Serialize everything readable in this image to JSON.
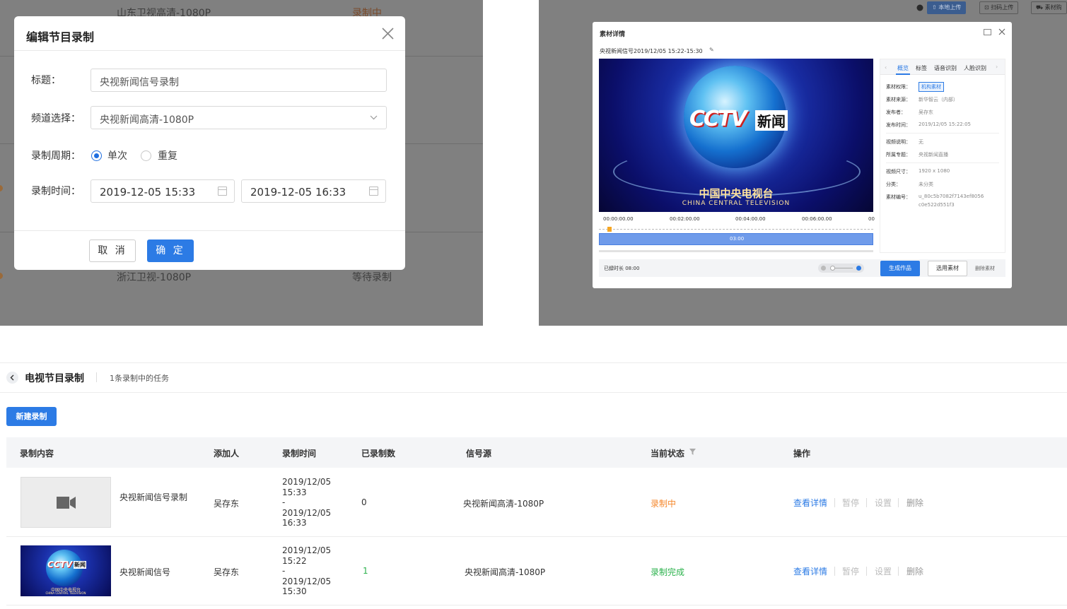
{
  "panel_a": {
    "background_rows": [
      {
        "channel": "山东卫视高清-1080P",
        "status": "录制中"
      },
      {
        "channel": "浙江卫视-1080P",
        "status": "等待录制"
      }
    ],
    "dialog": {
      "title": "编辑节目录制",
      "fields": {
        "title_label": "标题：",
        "title_value": "央视新闻信号录制",
        "channel_label": "频道选择：",
        "channel_value": "央视新闻高清-1080P",
        "period_label": "录制周期：",
        "period_options": [
          "单次",
          "重复"
        ],
        "period_selected": "单次",
        "time_label": "录制时间：",
        "time_start": "2019-12-05 15:33",
        "time_end": "2019-12-05 16:33"
      },
      "cancel_label": "取 消",
      "ok_label": "确 定"
    }
  },
  "panel_b": {
    "toolbar": {
      "local_upload": "本地上传",
      "scan_upload": "扫码上传",
      "material_cart": "素材购"
    },
    "window_title": "素材详情",
    "clip_title": "央视新闻信号2019/12/05 15:22-15:30",
    "video": {
      "logo_cctv": "CCTV",
      "logo_news": "新闻",
      "cn_name": "中国中央电视台",
      "en_name": "CHINA CENTRAL TELEVISION"
    },
    "timeline": {
      "ticks": [
        "00:00:00.00",
        "00:02:00.00",
        "00:04:00.00",
        "00:06:00.00",
        "00"
      ],
      "duration_label": "03:00",
      "recorded": "已録时长 08:00"
    },
    "tabs": [
      "概览",
      "标签",
      "语音识别",
      "人脸识别"
    ],
    "active_tab": "概览",
    "info": [
      {
        "k": "素材权限：",
        "v": "机构素材"
      },
      {
        "k": "素材来源：",
        "v": "新华智云（内部）"
      },
      {
        "k": "发布者：",
        "v": "吴存东"
      },
      {
        "k": "发布时间：",
        "v": "2019/12/05 15:22:05"
      },
      {
        "k": "视频说明：",
        "v": "无"
      },
      {
        "k": "所属专题：",
        "v": "央视新闻直播"
      },
      {
        "k": "视频尺寸：",
        "v": "1920 x 1080"
      },
      {
        "k": "分类：",
        "v": "未分类"
      },
      {
        "k": "素材编号：",
        "v": "u_80c5b7082f7143ef8056"
      },
      {
        "k": "",
        "v": "c0e522d551f3"
      }
    ],
    "footer": {
      "generate_btn": "生成作品",
      "select_btn": "选用素材",
      "delete_btn": "删除素材"
    }
  },
  "panel_c": {
    "page_title": "电视节目录制",
    "task_summary": "1条录制中的任务",
    "new_btn": "新建录制",
    "columns": [
      "录制内容",
      "添加人",
      "录制时间",
      "已录制数",
      "信号源",
      "当前状态",
      "操作"
    ],
    "rows": [
      {
        "name": "央视新闻信号录制",
        "adder": "吴存东",
        "time_start_date": "2019/12/05",
        "time_start_clock": "15:33",
        "dash": "-",
        "time_end_date": "2019/12/05",
        "time_end_clock": "16:33",
        "count": "0",
        "source": "央视新闻高清-1080P",
        "status": "录制中",
        "actions": [
          "查看详情",
          "暂停",
          "设置",
          "删除"
        ]
      },
      {
        "name": "央视新闻信号",
        "adder": "吴存东",
        "time_start_date": "2019/12/05",
        "time_start_clock": "15:22",
        "dash": "-",
        "time_end_date": "2019/12/05",
        "time_end_clock": "15:30",
        "count": "1",
        "source": "央视新闻高清-1080P",
        "status": "录制完成",
        "actions": [
          "查看详情",
          "暂停",
          "设置",
          "删除"
        ]
      }
    ],
    "thumb2": {
      "logo_cctv": "CCTV",
      "logo_news": "新闻",
      "cn_name": "中国中央电视台",
      "en_name": "CHINA CENTRAL TELEVISION"
    }
  },
  "colors": {
    "primary": "#2c7be5",
    "recording": "#f5872b",
    "done": "#2bb24c",
    "disabled": "#bbbbbb"
  }
}
